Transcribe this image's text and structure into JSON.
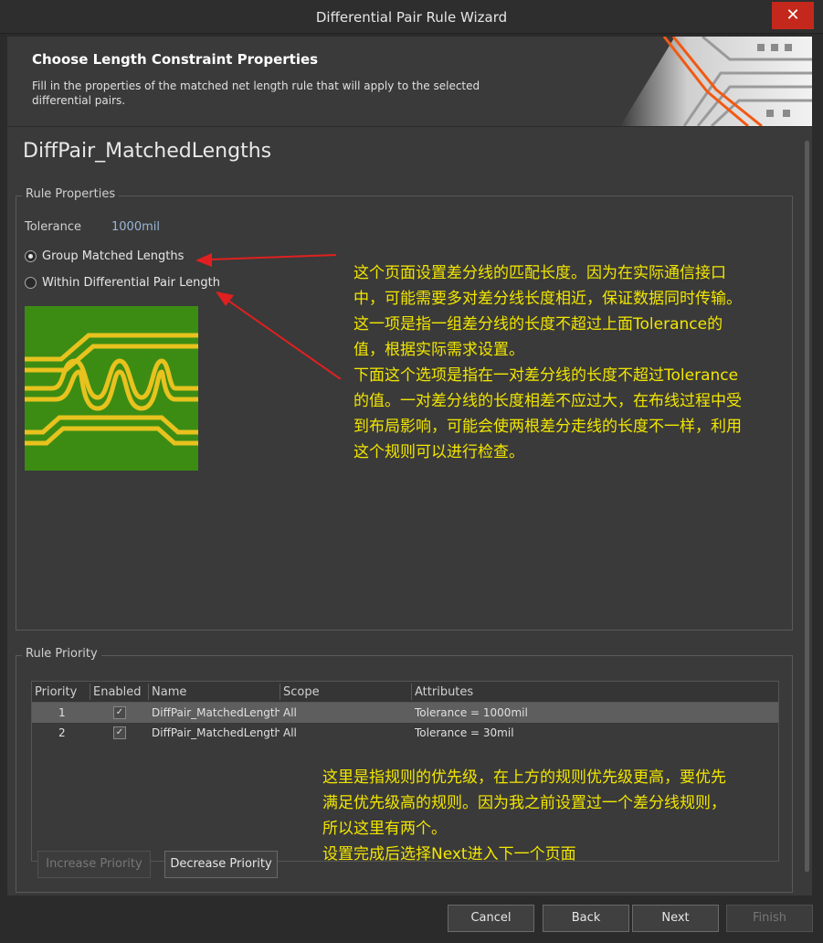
{
  "window": {
    "title": "Differential Pair Rule Wizard",
    "close_glyph": "✕"
  },
  "header": {
    "title": "Choose Length Constraint Properties",
    "description": "Fill in the properties of the matched net length rule that will apply to the selected differential pairs."
  },
  "rule_name": "DiffPair_MatchedLengths",
  "rule_properties": {
    "group_label": "Rule Properties",
    "tolerance_label": "Tolerance",
    "tolerance_value": "1000mil",
    "options": [
      {
        "label": "Group Matched Lengths",
        "selected": true
      },
      {
        "label": "Within Differential Pair Length",
        "selected": false
      }
    ]
  },
  "annotation_top": [
    "这个页面设置差分线的匹配长度。因为在实际通信接口",
    "中，可能需要多对差分线长度相近，保证数据同时传输。",
    "这一项是指一组差分线的长度不超过上面Tolerance的",
    "值，根据实际需求设置。",
    "下面这个选项是指在一对差分线的长度不超过Tolerance",
    "的值。一对差分线的长度相差不应过大，在布线过程中受",
    "到布局影响，可能会使两根差分走线的长度不一样，利用",
    "这个规则可以进行检查。"
  ],
  "rule_priority": {
    "group_label": "Rule Priority",
    "columns": [
      "Priority",
      "Enabled",
      "Name",
      "Scope",
      "Attributes"
    ],
    "rows": [
      {
        "priority": "1",
        "enabled": true,
        "name": "DiffPair_MatchedLengths",
        "scope": "All",
        "attributes": "Tolerance = 1000mil"
      },
      {
        "priority": "2",
        "enabled": true,
        "name": "DiffPair_MatchedLengths",
        "scope": "All",
        "attributes": "Tolerance = 30mil"
      }
    ],
    "increase_label": "Increase Priority",
    "decrease_label": "Decrease Priority"
  },
  "annotation_bottom": [
    "这里是指规则的优先级，在上方的规则优先级更高，要优先",
    "满足优先级高的规则。因为我之前设置过一个差分线规则，",
    "所以这里有两个。",
    "设置完成后选择Next进入下一个页面"
  ],
  "footer": {
    "cancel": "Cancel",
    "back": "Back",
    "next": "Next",
    "finish": "Finish"
  },
  "colors": {
    "annotation": "#f2e600",
    "arrow": "#e02020",
    "pcb_green": "#3c8c14",
    "pcb_trace": "#e8c21e"
  }
}
